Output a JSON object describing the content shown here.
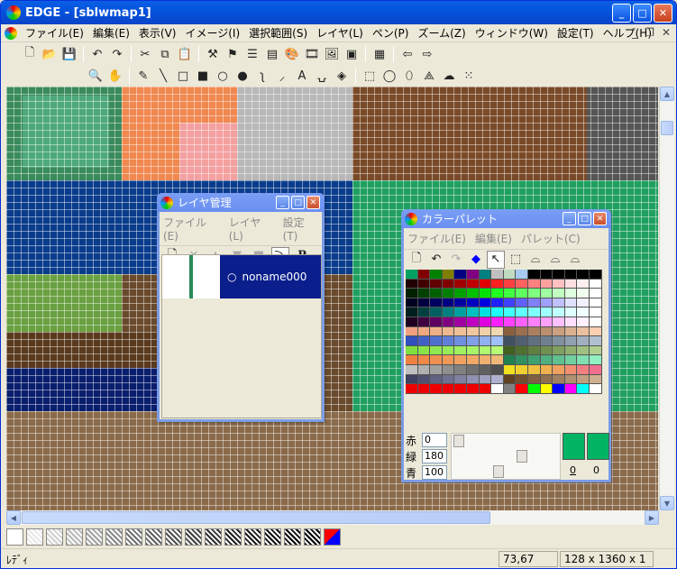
{
  "window": {
    "title": "EDGE - [sblwmap1]",
    "min": "_",
    "max": "□",
    "close": "✕"
  },
  "menu": [
    "ファイル(E)",
    "編集(E)",
    "表示(V)",
    "イメージ(I)",
    "選択範囲(S)",
    "レイヤ(L)",
    "ペン(P)",
    "ズーム(Z)",
    "ウィンドウ(W)",
    "設定(T)",
    "ヘルプ(H)"
  ],
  "mdi": {
    "min": "_",
    "restore": "❐",
    "close": "✕"
  },
  "toolbar1": [
    {
      "name": "new-icon",
      "glyph": "🗋"
    },
    {
      "name": "open-icon",
      "glyph": "📂"
    },
    {
      "name": "save-icon",
      "glyph": "💾"
    },
    {
      "name": "undo-icon",
      "glyph": "↶"
    },
    {
      "name": "redo-icon",
      "glyph": "↷"
    },
    {
      "name": "cut-icon",
      "glyph": "✂"
    },
    {
      "name": "copy-icon",
      "glyph": "⧉"
    },
    {
      "name": "paste-icon",
      "glyph": "📋"
    },
    {
      "name": "tool-a-icon",
      "glyph": "⚒"
    },
    {
      "name": "tool-b-icon",
      "glyph": "⚑"
    },
    {
      "name": "tool-c-icon",
      "glyph": "☰"
    },
    {
      "name": "tool-d-icon",
      "glyph": "▤"
    },
    {
      "name": "palette-icon",
      "glyph": "🎨"
    },
    {
      "name": "film-icon",
      "glyph": "🎞"
    },
    {
      "name": "image-icon",
      "glyph": "🖼"
    },
    {
      "name": "frame-icon",
      "glyph": "▣"
    },
    {
      "name": "grid-icon",
      "glyph": "▦"
    },
    {
      "name": "arrow-left-icon",
      "glyph": "⇦"
    },
    {
      "name": "arrow-right-icon",
      "glyph": "⇨"
    }
  ],
  "toolbar2": [
    {
      "name": "zoom-icon",
      "glyph": "🔍"
    },
    {
      "name": "hand-icon",
      "glyph": "✋"
    },
    {
      "name": "pen-icon",
      "glyph": "✎"
    },
    {
      "name": "line-icon",
      "glyph": "╲"
    },
    {
      "name": "rect-icon",
      "glyph": "□"
    },
    {
      "name": "rect-fill-icon",
      "glyph": "■"
    },
    {
      "name": "ellipse-icon",
      "glyph": "○"
    },
    {
      "name": "ellipse-fill-icon",
      "glyph": "●"
    },
    {
      "name": "curve-icon",
      "glyph": "ʅ"
    },
    {
      "name": "spoid-icon",
      "glyph": "⸝"
    },
    {
      "name": "text-icon",
      "glyph": "A"
    },
    {
      "name": "bucket-icon",
      "glyph": "⍽"
    },
    {
      "name": "fill-icon",
      "glyph": "◈"
    },
    {
      "name": "select-rect-icon",
      "glyph": "⬚"
    },
    {
      "name": "select-ellipse-icon",
      "glyph": "◯"
    },
    {
      "name": "select-lasso-icon",
      "glyph": "⬯"
    },
    {
      "name": "select-poly-icon",
      "glyph": "⟁"
    },
    {
      "name": "select-free-icon",
      "glyph": "☁"
    },
    {
      "name": "select-magic-icon",
      "glyph": "⁙"
    }
  ],
  "status": {
    "left": "ﾚﾃﾞｨ",
    "coord": "73,67",
    "size": "128 x 1360 x 1"
  },
  "layer_window": {
    "title": "レイヤ管理",
    "menu": [
      "ファイル(E)",
      "レイヤ(L)",
      "設定(T)"
    ],
    "layer_name": "noname000",
    "radio": "○",
    "p_label": "P"
  },
  "palette_window": {
    "title": "カラーパレット",
    "menu": [
      "ファイル(E)",
      "編集(E)",
      "パレット(C)"
    ],
    "r_label": "赤",
    "g_label": "緑",
    "b_label": "青",
    "r": "0",
    "g": "180",
    "b": "100",
    "idx_a": "0",
    "idx_b": "0"
  },
  "colors": {
    "accent": "#0552dd",
    "current": "#00b464"
  }
}
